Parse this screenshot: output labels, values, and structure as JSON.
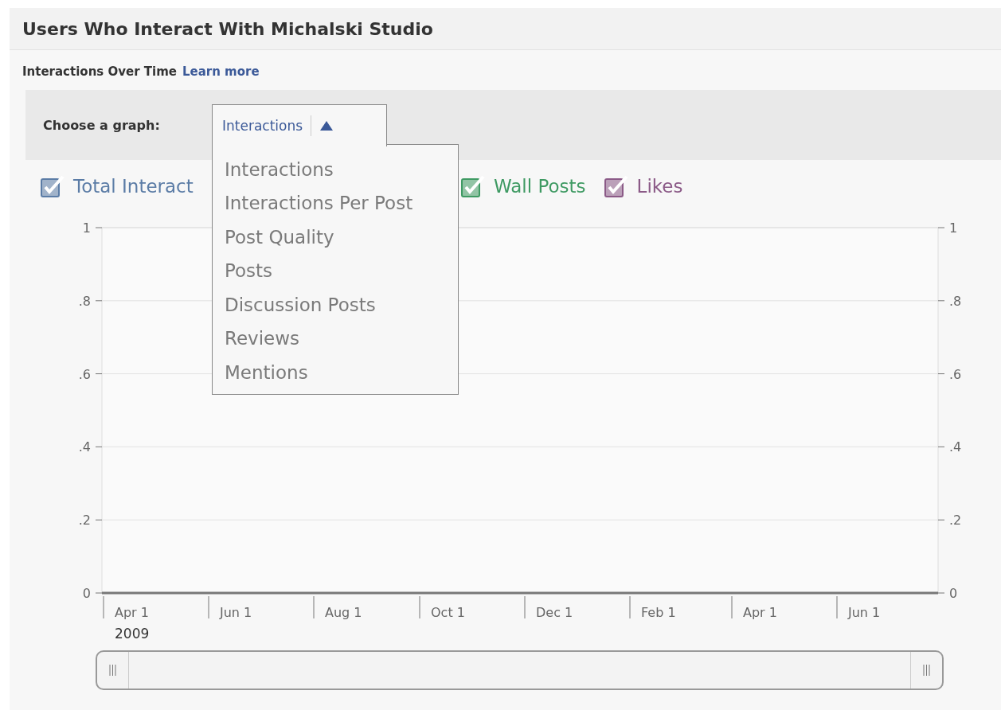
{
  "header": {
    "title": "Users Who Interact With Michalski Studio"
  },
  "section": {
    "title": "Interactions Over Time",
    "link": "Learn more"
  },
  "graph_picker": {
    "label": "Choose a graph:",
    "value": "Interactions",
    "expanded": true,
    "options": [
      "Interactions",
      "Interactions Per Post",
      "Post Quality",
      "Posts",
      "Discussion Posts",
      "Reviews",
      "Mentions"
    ]
  },
  "legend": [
    {
      "label": "Total Interact",
      "checked": true,
      "color": "#5b7ca6"
    },
    {
      "label": "Wall Posts",
      "checked": true,
      "color": "#3f9a63"
    },
    {
      "label": "Likes",
      "checked": true,
      "color": "#8b5a87"
    }
  ],
  "chart_data": {
    "type": "line",
    "categories": [
      "Apr 1",
      "Jun 1",
      "Aug 1",
      "Oct 1",
      "Dec 1",
      "Feb 1",
      "Apr 1",
      "Jun 1"
    ],
    "ylim": [
      0,
      1
    ],
    "yticks": [
      {
        "value": 0,
        "label": "0"
      },
      {
        "value": 0.2,
        "label": ".2"
      },
      {
        "value": 0.4,
        "label": ".4"
      },
      {
        "value": 0.6,
        "label": ".6"
      },
      {
        "value": 0.8,
        "label": ".8"
      },
      {
        "value": 1,
        "label": "1"
      }
    ],
    "grid": true
  },
  "axis_year": "2009"
}
